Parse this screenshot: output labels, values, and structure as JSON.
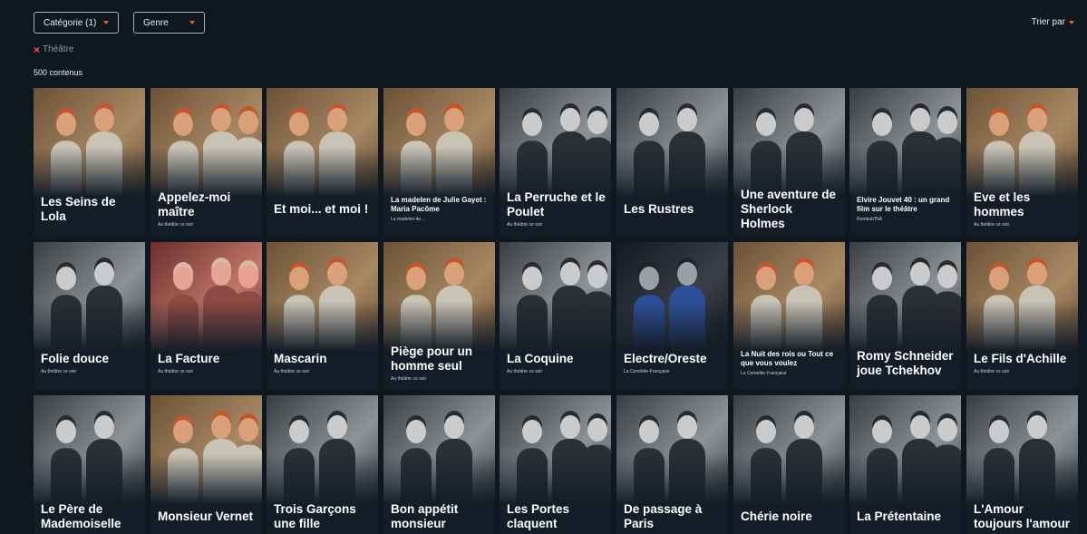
{
  "filters": {
    "category_label": "Catégorie (1)",
    "genre_label": "Genre",
    "sort_label": "Trier par",
    "active_chip": "Théâtre",
    "result_count": "500 contenus"
  },
  "colors": {
    "accent": "#ef5a3a",
    "background": "#0f1720",
    "card": "#141d27"
  },
  "cards": [
    {
      "title": "Les Seins de Lola",
      "sub": "",
      "small": false,
      "tone": "color"
    },
    {
      "title": "Appelez-moi maître",
      "sub": "Au théâtre ce soir",
      "small": false,
      "tone": "color"
    },
    {
      "title": "Et moi... et moi !",
      "sub": "",
      "small": false,
      "tone": "color"
    },
    {
      "title": "La madelen de Julie Gayet : Maria Pacôme",
      "sub": "La madelen de...",
      "small": true,
      "tone": "color"
    },
    {
      "title": "La Perruche et le Poulet",
      "sub": "Au théâtre ce soir",
      "small": false,
      "tone": "bw"
    },
    {
      "title": "Les Rustres",
      "sub": "",
      "small": false,
      "tone": "bw"
    },
    {
      "title": "Une aventure de Sherlock Holmes",
      "sub": "",
      "small": false,
      "tone": "bw"
    },
    {
      "title": "Elvire Jouvet 40 : un grand film sur le théâtre",
      "sub": "Rembob'INA",
      "small": true,
      "tone": "bw"
    },
    {
      "title": "Eve et les hommes",
      "sub": "Au théâtre ce soir",
      "small": false,
      "tone": "color"
    },
    {
      "title": "Folie douce",
      "sub": "Au théâtre ce soir",
      "small": false,
      "tone": "bw"
    },
    {
      "title": "La Facture",
      "sub": "Au théâtre ce soir",
      "small": false,
      "tone": "pink"
    },
    {
      "title": "Mascarin",
      "sub": "Au théâtre ce soir",
      "small": false,
      "tone": "color"
    },
    {
      "title": "Piège pour un homme seul",
      "sub": "Au théâtre ce soir",
      "small": false,
      "tone": "color"
    },
    {
      "title": "La Coquine",
      "sub": "Au théâtre ce soir",
      "small": false,
      "tone": "bw"
    },
    {
      "title": "Electre/Oreste",
      "sub": "La Comédie-Française",
      "small": false,
      "tone": "dark"
    },
    {
      "title": "La Nuit des rois ou Tout ce que vous voulez",
      "sub": "La Comédie-Française",
      "small": true,
      "tone": "color"
    },
    {
      "title": "Romy Schneider joue Tchekhov",
      "sub": "",
      "small": false,
      "tone": "bw"
    },
    {
      "title": "Le Fils d'Achille",
      "sub": "Au théâtre ce soir",
      "small": false,
      "tone": "color"
    },
    {
      "title": "Le Père de Mademoiselle",
      "sub": "",
      "small": false,
      "tone": "bw"
    },
    {
      "title": "Monsieur Vernet",
      "sub": "",
      "small": false,
      "tone": "color"
    },
    {
      "title": "Trois Garçons une fille",
      "sub": "",
      "small": false,
      "tone": "bw"
    },
    {
      "title": "Bon appétit monsieur",
      "sub": "",
      "small": false,
      "tone": "bw"
    },
    {
      "title": "Les Portes claquent",
      "sub": "",
      "small": false,
      "tone": "bw"
    },
    {
      "title": "De passage à Paris",
      "sub": "",
      "small": false,
      "tone": "bw"
    },
    {
      "title": "Chérie noire",
      "sub": "",
      "small": false,
      "tone": "bw"
    },
    {
      "title": "La Prétentaine",
      "sub": "",
      "small": false,
      "tone": "bw"
    },
    {
      "title": "L'Amour toujours l'amour",
      "sub": "",
      "small": false,
      "tone": "bw"
    }
  ]
}
